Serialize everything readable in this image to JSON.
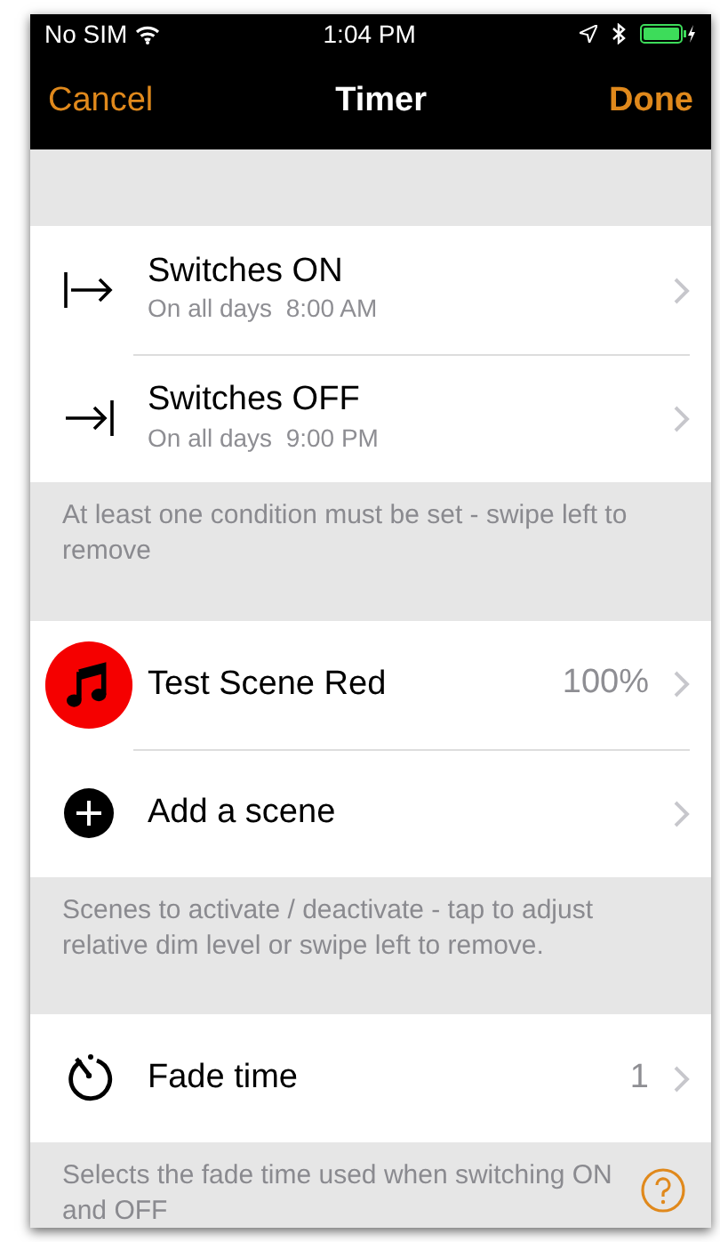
{
  "status_bar": {
    "carrier": "No SIM",
    "time": "1:04 PM"
  },
  "nav": {
    "cancel": "Cancel",
    "title": "Timer",
    "done": "Done"
  },
  "sections": [
    {
      "rows": [
        {
          "kind": "on",
          "title": "Switches ON",
          "subtitle": "On all days  8:00 AM"
        },
        {
          "kind": "off",
          "title": "Switches OFF",
          "subtitle": "On all days  9:00 PM"
        }
      ],
      "footer": "At least one condition must be set - swipe left to remove"
    },
    {
      "rows": [
        {
          "kind": "scene",
          "title": "Test Scene Red",
          "value": "100%",
          "color": "#f50000"
        },
        {
          "kind": "add",
          "title": "Add a scene"
        }
      ],
      "footer": "Scenes to activate / deactivate - tap to adjust relative dim level or swipe left to remove."
    },
    {
      "rows": [
        {
          "kind": "fade",
          "title": "Fade time",
          "value": "1"
        }
      ],
      "footer": "Selects the fade time used when switching ON and OFF"
    }
  ]
}
